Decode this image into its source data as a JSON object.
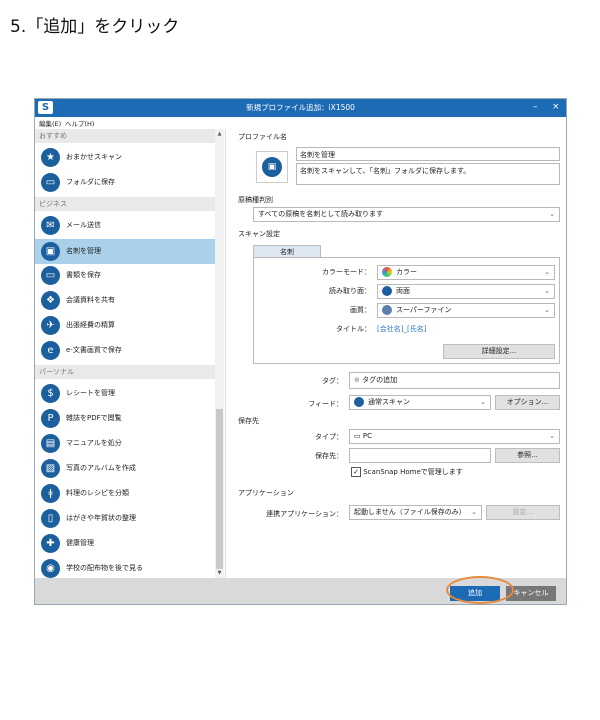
{
  "instruction": "5.「追加」をクリック",
  "window": {
    "title": "新規プロファイル追加：iX1500",
    "logo": "S",
    "minimize": "–",
    "close": "×"
  },
  "menu": {
    "edit": "編集(E)",
    "help": "ヘルプ(H)"
  },
  "sidebar": {
    "sections": [
      {
        "header": "おすすめ",
        "items": [
          {
            "label": "おまかせスキャン",
            "icon": "star-icon",
            "glyph": "★"
          },
          {
            "label": "フォルダに保存",
            "icon": "folder-icon",
            "glyph": "▭"
          }
        ]
      },
      {
        "header": "ビジネス",
        "items": [
          {
            "label": "メール送信",
            "icon": "mail-icon",
            "glyph": "✉"
          },
          {
            "label": "名刺を管理",
            "icon": "business-card-icon",
            "glyph": "▣",
            "selected": true
          },
          {
            "label": "書類を保存",
            "icon": "folder-icon",
            "glyph": "▭"
          },
          {
            "label": "会議資料を共有",
            "icon": "people-icon",
            "glyph": "❖"
          },
          {
            "label": "出張経費の精算",
            "icon": "airplane-icon",
            "glyph": "✈"
          },
          {
            "label": "e-文書画質で保存",
            "icon": "e-document-icon",
            "glyph": "e"
          }
        ]
      },
      {
        "header": "パーソナル",
        "items": [
          {
            "label": "レシートを管理",
            "icon": "receipt-icon",
            "glyph": "$"
          },
          {
            "label": "雑誌をPDFで閲覧",
            "icon": "magazine-icon",
            "glyph": "P"
          },
          {
            "label": "マニュアルを処分",
            "icon": "manual-icon",
            "glyph": "▤"
          },
          {
            "label": "写真のアルバムを作成",
            "icon": "photo-icon",
            "glyph": "▨"
          },
          {
            "label": "料理のレシピを分類",
            "icon": "cutlery-icon",
            "glyph": "ǂ"
          },
          {
            "label": "はがきや年賀状の整理",
            "icon": "postcard-icon",
            "glyph": "▯"
          },
          {
            "label": "健康管理",
            "icon": "health-icon",
            "glyph": "✚"
          },
          {
            "label": "学校の配布物を後で見る",
            "icon": "school-icon",
            "glyph": "◉"
          }
        ]
      }
    ]
  },
  "main": {
    "profile_name_label": "プロファイル名",
    "profile_name": "名刺を管理",
    "profile_description": "名刺をスキャンして、「名刺」フォルダに保存します。",
    "doc_type_label": "原稿種判別",
    "doc_type_value": "すべての原稿を名刺として読み取ります",
    "scan_settings_label": "スキャン設定",
    "tab_label": "名刺",
    "color_mode_label": "カラーモード：",
    "color_mode_value": "カラー",
    "scan_side_label": "読み取り面：",
    "scan_side_value": "両面",
    "quality_label": "画質：",
    "quality_value": "スーパーファイン",
    "title_label": "タイトル：",
    "title_value": "[会社名]_[氏名]",
    "detail_button": "詳細設定...",
    "tag_label": "タグ：",
    "tag_value": "タグの追加",
    "feed_label": "フィード：",
    "feed_value": "通常スキャン",
    "options_button": "オプション...",
    "save_dest_label": "保存先",
    "type_label": "タイプ：",
    "type_value": "PC",
    "save_path_label": "保存先：",
    "browse_button": "参照...",
    "manage_checkbox": "ScanSnap Homeで管理します",
    "application_label": "アプリケーション",
    "linked_app_label": "連携アプリケーション：",
    "linked_app_value": "起動しません（ファイル保存のみ）",
    "settings_button": "設定..."
  },
  "footer": {
    "add_button": "追加",
    "cancel_button": "キャンセル"
  },
  "colors": {
    "accent": "#1e6bb5",
    "selected": "#a9d2ea",
    "highlight": "#e78a3b"
  }
}
